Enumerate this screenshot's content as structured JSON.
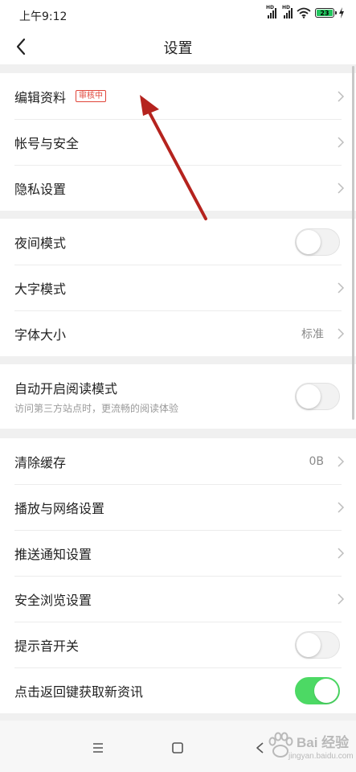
{
  "status_bar": {
    "time": "上午9:12",
    "signal_label": "HD",
    "battery_level": "23",
    "icons": [
      "hd-signal-icon",
      "hd-signal-icon",
      "wifi-icon",
      "battery-icon",
      "charging-icon"
    ]
  },
  "header": {
    "title": "设置",
    "back_icon": "chevron-left-icon"
  },
  "groups": [
    {
      "items": [
        {
          "label": "编辑资料",
          "badge": "审核中",
          "control": "chevron"
        },
        {
          "label": "帐号与安全",
          "control": "chevron"
        },
        {
          "label": "隐私设置",
          "control": "chevron"
        }
      ]
    },
    {
      "items": [
        {
          "label": "夜间模式",
          "control": "toggle",
          "on": false
        },
        {
          "label": "大字模式",
          "control": "chevron"
        },
        {
          "label": "字体大小",
          "value": "标准",
          "control": "chevron"
        }
      ]
    },
    {
      "items": [
        {
          "label": "自动开启阅读模式",
          "sublabel": "访问第三方站点时，更流畅的阅读体验",
          "control": "toggle",
          "on": false
        }
      ]
    },
    {
      "items": [
        {
          "label": "清除缓存",
          "value": "0B",
          "control": "chevron"
        },
        {
          "label": "播放与网络设置",
          "control": "chevron"
        },
        {
          "label": "推送通知设置",
          "control": "chevron"
        },
        {
          "label": "安全浏览设置",
          "control": "chevron"
        },
        {
          "label": "提示音开关",
          "control": "toggle",
          "on": false
        },
        {
          "label": "点击返回键获取新资讯",
          "control": "toggle",
          "on": true
        }
      ]
    }
  ],
  "nav_bar": {
    "icons": [
      "menu-icon",
      "home-square-icon",
      "back-triangle-icon"
    ]
  },
  "watermark": {
    "text": "Bai 经验",
    "url": "jingyan.baidu.com"
  },
  "colors": {
    "toggle_on": "#4cd964",
    "badge": "#e0453a",
    "annotation_arrow": "#b5231e",
    "background": "#f0f0f0"
  }
}
